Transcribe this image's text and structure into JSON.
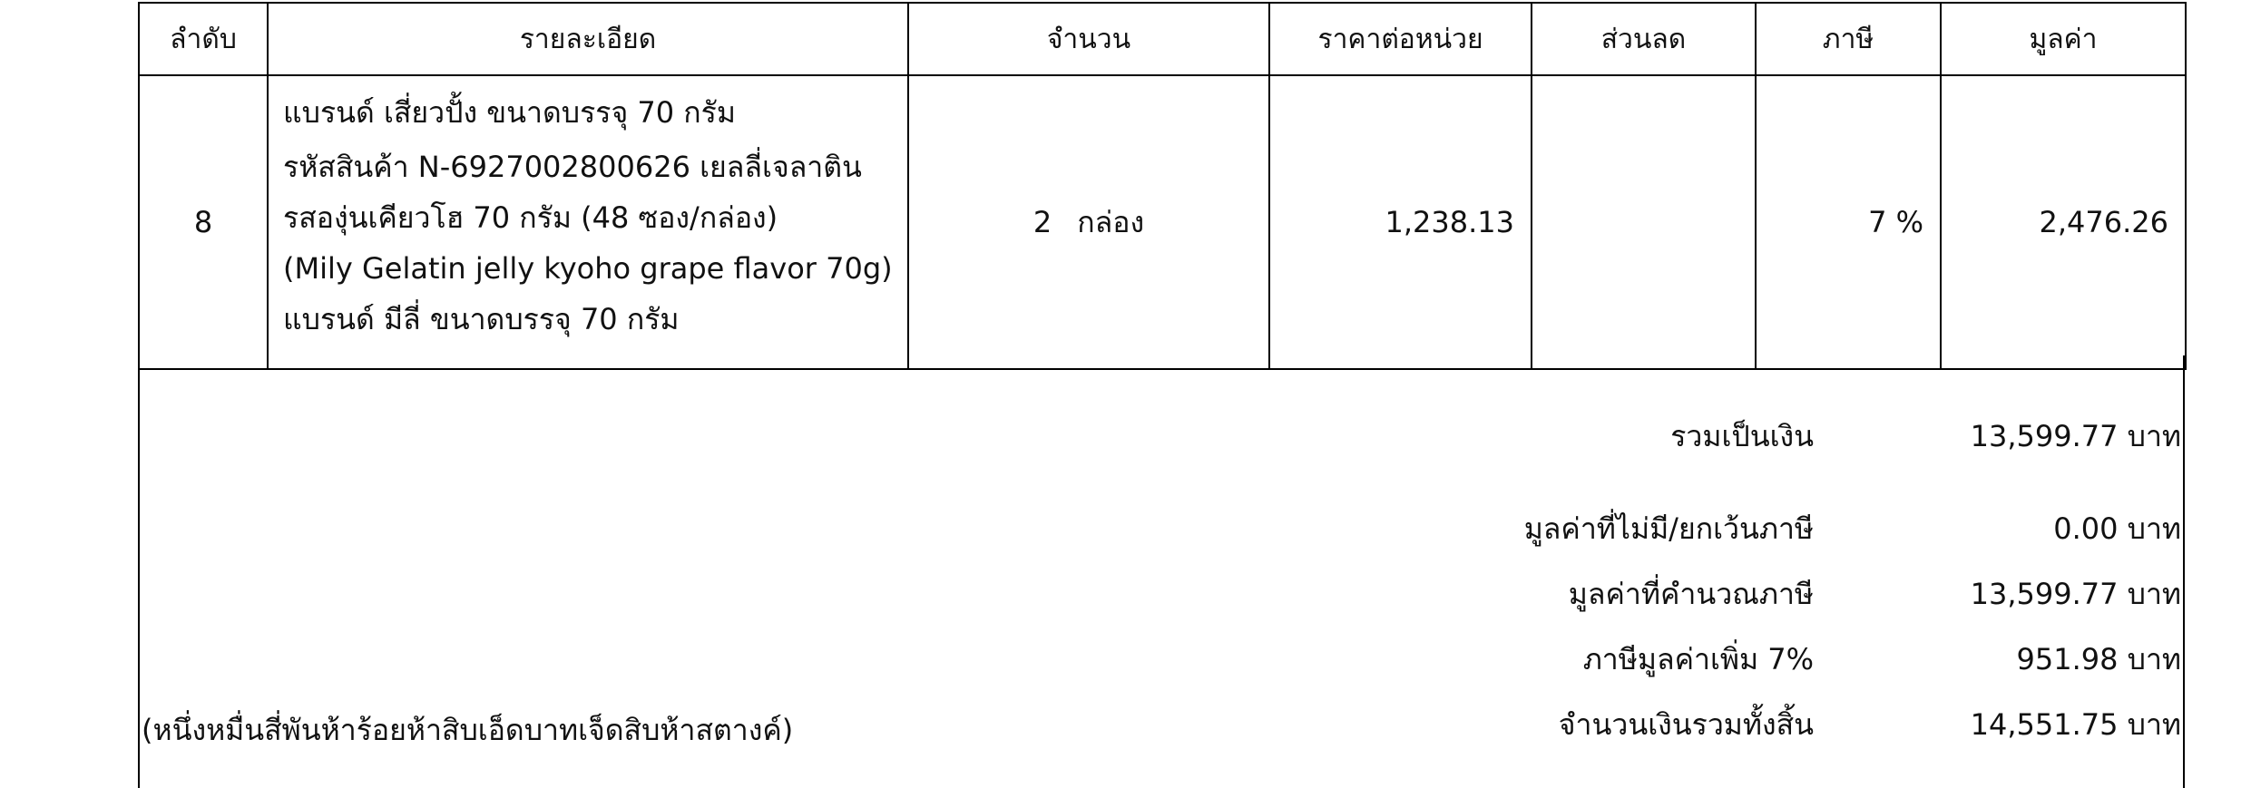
{
  "table": {
    "headers": [
      "ลำดับ",
      "รายละเอียด",
      "จำนวน",
      "ราคาต่อหน่วย",
      "ส่วนลด",
      "ภาษี",
      "มูลค่า"
    ],
    "row": {
      "no": "8",
      "description": [
        "แบรนด์ เสี่ยวปั้ง ขนาดบรรจุ 70 กรัม",
        "รหัสสินค้า N-6927002800626 เยลลี่เจลาติน",
        "รสองุ่นเคียวโฮ 70 กรัม (48 ซอง/กล่อง)",
        "(Mily Gelatin jelly kyoho grape flavor 70g)",
        "แบรนด์ มีลี่ ขนาดบรรจุ 70 กรัม"
      ],
      "quantity": "2",
      "unit": "กล่อง",
      "unit_price": "1,238.13",
      "discount": "",
      "tax": "7 %",
      "amount": "2,476.26"
    }
  },
  "summary": {
    "subtotal": {
      "label": "รวมเป็นเงิน",
      "value": "13,599.77 บาท"
    },
    "non_taxable": {
      "label": "มูลค่าที่ไม่มี/ยกเว้นภาษี",
      "value": "0.00 บาท"
    },
    "taxable": {
      "label": "มูลค่าที่คำนวณภาษี",
      "value": "13,599.77 บาท"
    },
    "vat": {
      "label": "ภาษีมูลค่าเพิ่ม 7%",
      "value": "951.98 บาท"
    },
    "grand_total": {
      "label": "จำนวนเงินรวมทั้งสิ้น",
      "value": "14,551.75 บาท"
    },
    "amount_in_words": "(หนึ่งหมื่นสี่พันห้าร้อยห้าสิบเอ็ดบาทเจ็ดสิบห้าสตางค์)"
  }
}
